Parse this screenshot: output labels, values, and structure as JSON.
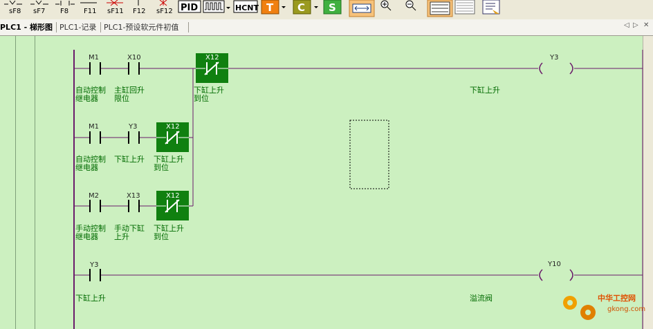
{
  "toolbar": {
    "key_labels": [
      "sF8",
      "sF7",
      "F8",
      "F11",
      "sF11",
      "F12",
      "sF12"
    ],
    "buttons": [
      "PID",
      "HCNT",
      "T",
      "C",
      "S"
    ]
  },
  "tabs": {
    "active": "PLC1 - 梯形图",
    "items": [
      "PLC1-记录",
      "PLC1-预设软元件初值"
    ]
  },
  "rungs": [
    {
      "contacts": [
        {
          "name": "M1",
          "label": [
            "自动控制",
            "继电器"
          ]
        },
        {
          "name": "X10",
          "label": [
            "主缸回升",
            "限位"
          ]
        },
        {
          "name": "X12",
          "label": [
            "下缸上升",
            "到位"
          ]
        }
      ],
      "coil": {
        "name": "Y3",
        "label": "下缸上升"
      }
    },
    {
      "contacts": [
        {
          "name": "M1",
          "label": [
            "自动控制",
            "继电器"
          ]
        },
        {
          "name": "Y3",
          "label": [
            "下缸上升"
          ]
        },
        {
          "name": "X12",
          "label": [
            "下缸上升",
            "到位"
          ]
        }
      ]
    },
    {
      "contacts": [
        {
          "name": "M2",
          "label": [
            "手动控制",
            "继电器"
          ]
        },
        {
          "name": "X13",
          "label": [
            "手动下缸",
            "上升"
          ]
        },
        {
          "name": "X12",
          "label": [
            "下缸上升",
            "到位"
          ]
        }
      ]
    },
    {
      "contacts": [
        {
          "name": "Y3",
          "label": [
            "下缸上升"
          ]
        }
      ],
      "coil": {
        "name": "Y10",
        "label": "溢流阀"
      }
    }
  ],
  "watermark": {
    "text": "中华工控网",
    "url": "gkong.com"
  },
  "colors": {
    "canvas": "#ccf0c0",
    "rung": "#6a1a6a",
    "highlight": "#108010",
    "label": "#006a00"
  }
}
